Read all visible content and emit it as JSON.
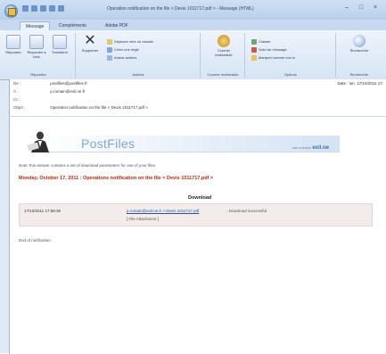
{
  "window": {
    "title": "Operation notification on the file < Devis 1011717.pdf > - Message (HTML)",
    "controls": [
      "–",
      "□",
      "×"
    ]
  },
  "ribbon": {
    "tabs": [
      "Message",
      "Compléments",
      "Adobe PDF"
    ],
    "groups": {
      "respond": {
        "label": "Répondre",
        "buttons": [
          "Répondre",
          "Répondre à tous",
          "Transférer"
        ]
      },
      "actions": {
        "label": "Actions",
        "delete": "Supprimer",
        "small": [
          "Déplacer vers un dossier",
          "Créer une règle",
          "Autres actions"
        ]
      },
      "junk": {
        "label": "Courrier indésirable",
        "button": "Courrier indésirable"
      },
      "options": {
        "label": "Options",
        "small": [
          "Classer",
          "Suivi du message",
          "Marquer comme non lu"
        ]
      },
      "find": {
        "label": "Rechercher",
        "button": "Rechercher"
      }
    }
  },
  "header": {
    "from_label": "De :",
    "from": "postfiles@postfiles.fr",
    "to_label": "À :",
    "to": "p.romain@exil.ne.fr",
    "cc_label": "Cc :",
    "cc": "",
    "subject_label": "Objet :",
    "subject": "Operation notification on the file < Devis 1011717.pdf >",
    "sent_label": "Date :",
    "sent": "lun. 17/10/2011 17:"
  },
  "email": {
    "brand": "PostFiles",
    "brand_tag_prefix": "une solution",
    "brand_tag_name": "exil.ne",
    "note": "Note: this answer contains a set of download parameters for one of your files.",
    "headline": "Monday, October 17, 2011 : Operations notification on the file < Devis 1011717.pdf >",
    "download_title": "Download",
    "row": {
      "date": "17/10/2011 17:58:36",
      "link": "p.romain@exil.ne.fr > Devis 1011717.pdf",
      "status": "- Download successful",
      "sub": "[ File Attachment ]"
    },
    "footer": "End of notification"
  },
  "colors": {
    "accent": "#cc2200",
    "link": "#2255aa",
    "ribbon": "#d6e4f4",
    "brand": "#7aa6d8"
  }
}
